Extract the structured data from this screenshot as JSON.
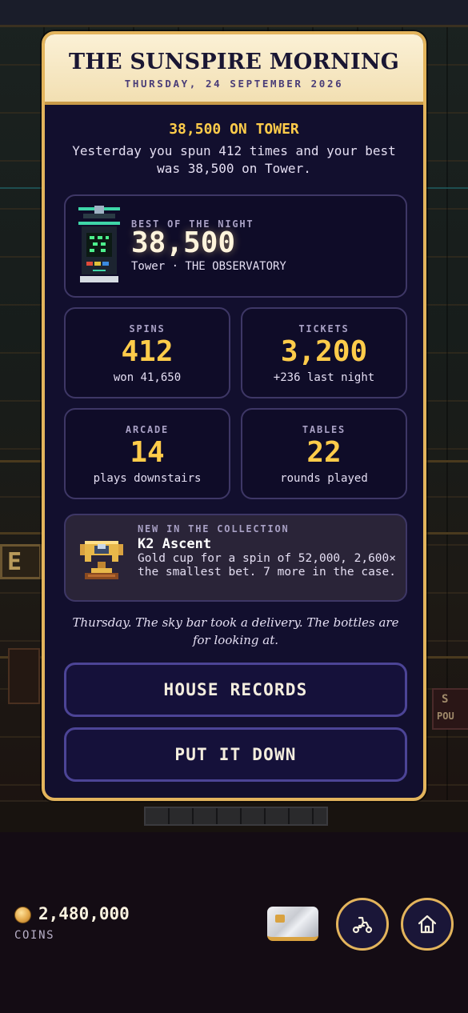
{
  "newspaper": {
    "title": "THE SUNSPIRE MORNING",
    "date": "THURSDAY, 24 SEPTEMBER 2026",
    "headline": "38,500 ON TOWER",
    "lede": "Yesterday you spun 412 times and your best was 38,500 on Tower."
  },
  "best_of_night": {
    "label": "BEST OF THE NIGHT",
    "score": "38,500",
    "location": "Tower · THE OBSERVATORY",
    "icon": "slot-machine-icon"
  },
  "stats": [
    {
      "label": "SPINS",
      "value": "412",
      "sub": "won 41,650"
    },
    {
      "label": "TICKETS",
      "value": "3,200",
      "sub": "+236 last night"
    },
    {
      "label": "ARCADE",
      "value": "14",
      "sub": "plays downstairs"
    },
    {
      "label": "TABLES",
      "value": "22",
      "sub": "rounds played"
    }
  ],
  "collection": {
    "label": "NEW IN THE COLLECTION",
    "name": "K2 Ascent",
    "description": "Gold cup for a spin of 52,000, 2,600× the smallest bet. 7 more in the case.",
    "icon": "trophy-icon"
  },
  "quip": "Thursday. The sky bar took a delivery. The bottles are for looking at.",
  "buttons": {
    "records": "HOUSE RECORDS",
    "dismiss": "PUT IT DOWN"
  },
  "hud": {
    "coins": "2,480,000",
    "coins_label": "COINS",
    "icons": [
      "coin-icon",
      "credit-card-icon",
      "scooter-icon",
      "home-icon"
    ]
  },
  "colors": {
    "gold": "#ffcc4a",
    "frame": "#e3b45c",
    "panel": "#120f2e",
    "button_border": "#4c4496"
  }
}
